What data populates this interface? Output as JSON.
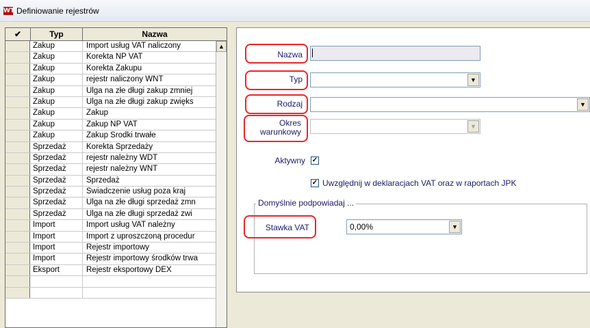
{
  "window": {
    "icon_text": "WT",
    "title": "Definiowanie rejestrów"
  },
  "grid": {
    "columns": {
      "check": "✔",
      "typ": "Typ",
      "nazwa": "Nazwa"
    },
    "rows": [
      {
        "typ": "Zakup",
        "nazwa": "Import usług VAT naliczony"
      },
      {
        "typ": "Zakup",
        "nazwa": "Korekta NP VAT"
      },
      {
        "typ": "Zakup",
        "nazwa": "Korekta Zakupu"
      },
      {
        "typ": "Zakup",
        "nazwa": "rejestr naliczony WNT"
      },
      {
        "typ": "Zakup",
        "nazwa": "Ulga na złe długi zakup zmniej"
      },
      {
        "typ": "Zakup",
        "nazwa": "Ulga na złe długi zakup zwięks"
      },
      {
        "typ": "Zakup",
        "nazwa": "Zakup"
      },
      {
        "typ": "Zakup",
        "nazwa": "Zakup NP VAT"
      },
      {
        "typ": "Zakup",
        "nazwa": "Zakup Środki trwałe"
      },
      {
        "typ": "Sprzedaż",
        "nazwa": "Korekta Sprzedaży"
      },
      {
        "typ": "Sprzedaż",
        "nazwa": "rejestr należny WDT"
      },
      {
        "typ": "Sprzedaż",
        "nazwa": "rejestr należny WNT"
      },
      {
        "typ": "Sprzedaż",
        "nazwa": "Sprzedaż"
      },
      {
        "typ": "Sprzedaż",
        "nazwa": "Świadczenie usług poza kraj"
      },
      {
        "typ": "Sprzedaż",
        "nazwa": "Ulga na złe długi sprzedaż zmn"
      },
      {
        "typ": "Sprzedaż",
        "nazwa": "Ulga na złe długi sprzedaż zwi"
      },
      {
        "typ": "Import",
        "nazwa": "Import usług VAT należny"
      },
      {
        "typ": "Import",
        "nazwa": "Import z uproszczoną procedur"
      },
      {
        "typ": "Import",
        "nazwa": "Rejestr importowy"
      },
      {
        "typ": "Import",
        "nazwa": "Rejestr importowy środków trwa"
      },
      {
        "typ": "Eksport",
        "nazwa": "Rejestr eksportowy DEX"
      },
      {
        "typ": "",
        "nazwa": ""
      },
      {
        "typ": "",
        "nazwa": ""
      }
    ],
    "scroll_up_icon": "arrow-up-icon"
  },
  "form": {
    "nazwa_label": "Nazwa",
    "nazwa_value": "",
    "typ_label": "Typ",
    "typ_value": "",
    "rodzaj_label": "Rodzaj",
    "rodzaj_value": "",
    "okres_label_1": "Okres",
    "okres_label_2": "warunkowy",
    "okres_value": "",
    "aktywny_label": "Aktywny",
    "aktywny_checked": true,
    "uwzglednij_label": "Uwzględnij w deklaracjach VAT oraz w raportach JPK",
    "uwzglednij_checked": true,
    "group_title": "Domyślnie podpowiadaj ...",
    "stawka_label": "Stawka VAT",
    "stawka_value": "0,00%"
  },
  "colors": {
    "highlight": "#e8262a",
    "label_text": "#1a1a6a"
  }
}
